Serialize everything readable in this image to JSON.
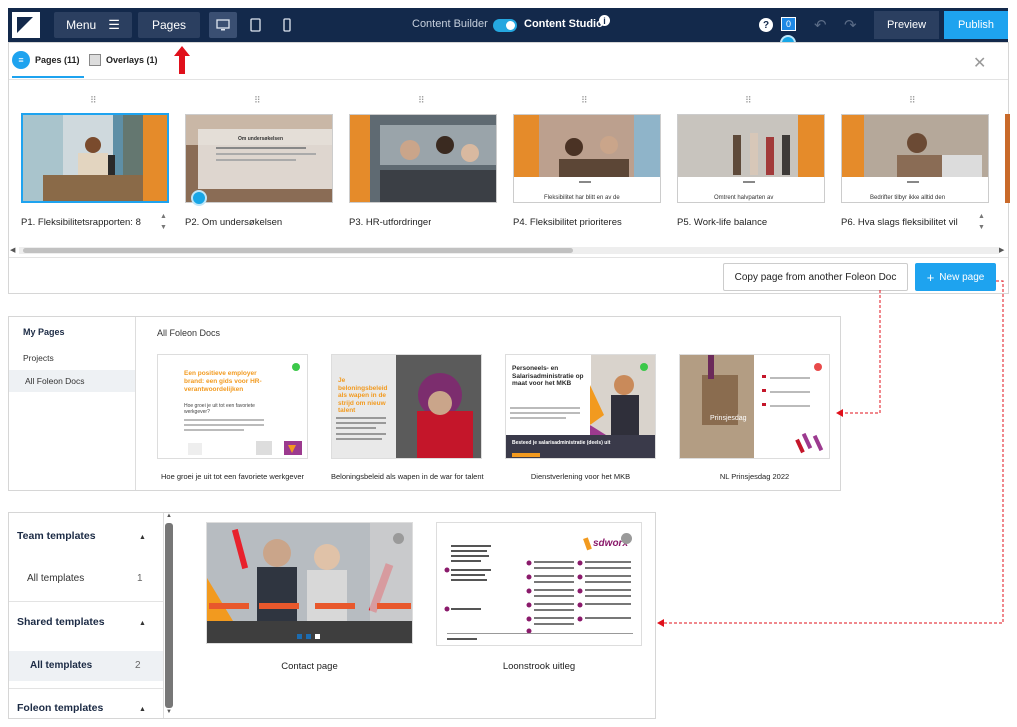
{
  "topbar": {
    "menu_label": "Menu",
    "pages_label": "Pages",
    "content_builder_label": "Content Builder",
    "content_studio_label": "Content Studio",
    "info_label": "i",
    "help_label": "?",
    "notification_count": "0",
    "preview_label": "Preview",
    "publish_label": "Publish"
  },
  "pages_panel": {
    "tabs": [
      {
        "label": "Pages (11)"
      },
      {
        "label": "Overlays (1)"
      }
    ],
    "pages": [
      {
        "label": "P1.  Fleksibilitetsrapporten: 8",
        "thumb_text": ""
      },
      {
        "label": "P2.  Om undersøkelsen",
        "thumb_text": "Om undersøkelsen"
      },
      {
        "label": "P3.  HR-utfordringer",
        "thumb_text": ""
      },
      {
        "label": "P4.  Fleksibilitet prioriteres",
        "thumb_text": "Fleksibilitet har blitt en av de"
      },
      {
        "label": "P5.  Work-life balance",
        "thumb_text": "Omtrent halvparten av"
      },
      {
        "label": "P6.  Hva slags fleksibilitet vil",
        "thumb_text": "Bedrifter tilbyr ikke alltid den"
      }
    ],
    "copy_button_label": "Copy page from another Foleon Doc",
    "new_page_button_label": "New page",
    "new_page_plus": "+"
  },
  "my_pages_panel": {
    "sidebar_title": "My Pages",
    "sidebar_items": [
      "Projects",
      "All Foleon Docs"
    ],
    "section_title": "All Foleon Docs",
    "docs": [
      {
        "caption": "Hoe groei je uit tot een favoriete werkgever",
        "heading": "Een positieve employer brand: een gids voor HR-verantwoordelijken",
        "subheading": "Hoe groei je uit tot een favoriete werkgever?",
        "status_color": "#3cc84a"
      },
      {
        "caption": "Beloningsbeleid als wapen in de war for talent",
        "heading": "Je beloningsbeleid als wapen in de strijd om nieuw talent",
        "subheading": "",
        "status_color": "#3cc84a"
      },
      {
        "caption": "Dienstverlening voor het MKB",
        "heading": "Personeels- en Salarisadministratie op maat voor het MKB",
        "subheading": "Besteed je salarisadministratie (deels) uit",
        "status_color": "#3cc84a"
      },
      {
        "caption": "NL Prinsjesdag 2022",
        "heading": "Prinsjesdag",
        "subheading": "",
        "status_color": "#e84a4a"
      }
    ]
  },
  "templates_panel": {
    "groups": [
      {
        "title": "Team templates",
        "item": "All templates",
        "count": "1"
      },
      {
        "title": "Shared templates",
        "item": "All templates",
        "count": "2"
      },
      {
        "title": "Foleon templates",
        "item": "",
        "count": ""
      }
    ],
    "templates": [
      {
        "caption": "Contact page"
      },
      {
        "caption": "Loonstrook uitleg",
        "logo_text": "sdworx"
      }
    ]
  },
  "colors": {
    "topbar_bg": "#13294b",
    "accent": "#1ea3ef",
    "annotation_red": "#e0101b"
  },
  "icons": [
    "menu-icon",
    "desktop-icon",
    "tablet-icon",
    "mobile-icon",
    "info-icon",
    "help-icon",
    "undo-icon",
    "redo-icon",
    "close-icon",
    "list-icon",
    "overlay-icon",
    "plus-icon",
    "drag-handle-icon",
    "caret-up-icon",
    "red-arrow-up-icon"
  ]
}
